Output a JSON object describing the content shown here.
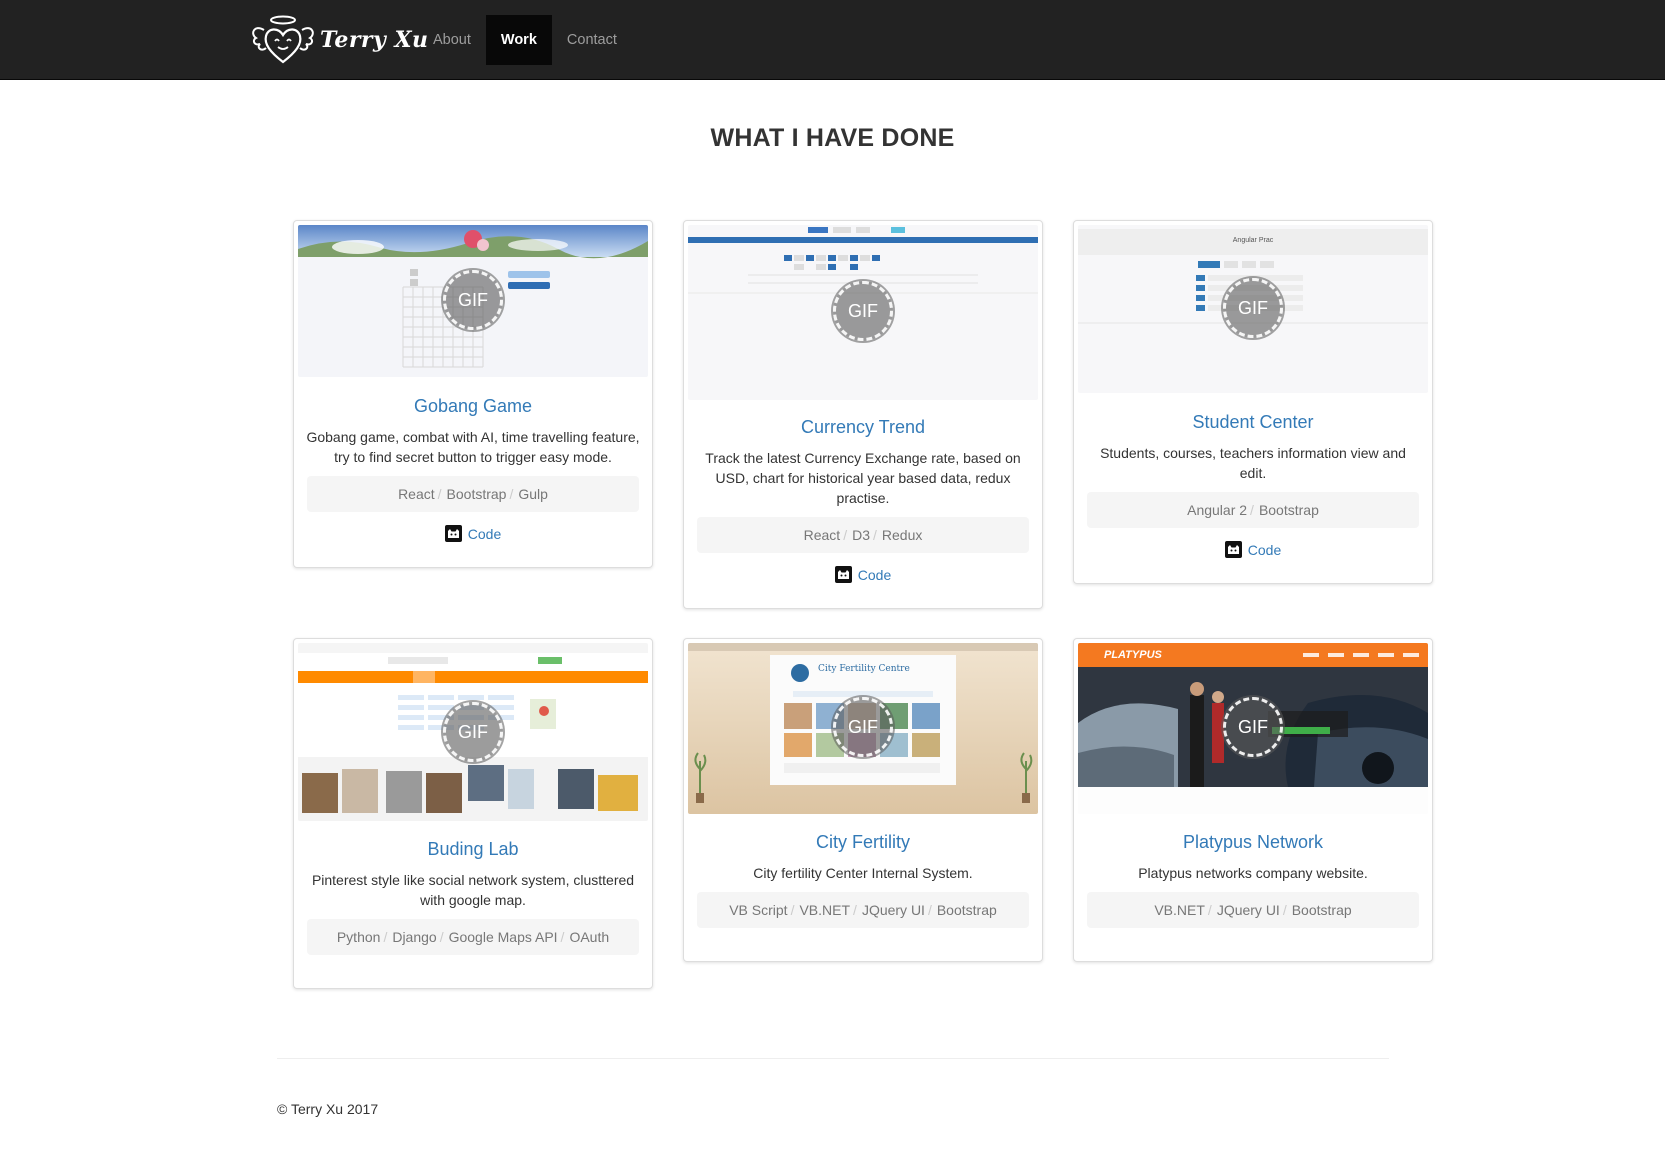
{
  "brand": {
    "name": "Terry Xu",
    "logo_icon": "winged-heart-icon"
  },
  "nav": {
    "items": [
      {
        "label": "About"
      },
      {
        "label": "Work"
      },
      {
        "label": "Contact"
      }
    ],
    "active": "Work"
  },
  "section": {
    "title": "WHAT I HAVE DONE"
  },
  "gif_label": "GIF",
  "projects": [
    {
      "title": "Gobang Game",
      "description": "Gobang game, combat with AI, time travelling feature, try to find secret button to trigger easy mode.",
      "tags": [
        "React",
        "Bootstrap",
        "Gulp"
      ],
      "code_label": "Code"
    },
    {
      "title": "Currency Trend",
      "description": "Track the latest Currency Exchange rate, based on USD, chart for historical year based data, redux practise.",
      "tags": [
        "React",
        "D3",
        "Redux"
      ],
      "code_label": "Code"
    },
    {
      "title": "Student Center",
      "description": "Students, courses, teachers information view and edit.",
      "tags": [
        "Angular 2",
        "Bootstrap"
      ],
      "code_label": "Code",
      "thumb_title": "Angular Prac"
    },
    {
      "title": "Buding Lab",
      "description": "Pinterest style like social network system, clusttered with google map.",
      "tags": [
        "Python",
        "Django",
        "Google Maps API",
        "OAuth"
      ]
    },
    {
      "title": "City Fertility",
      "description": "City fertility Center Internal System.",
      "tags": [
        "VB Script",
        "VB.NET",
        "JQuery UI",
        "Bootstrap"
      ],
      "thumb_title": "City Fertility Centre"
    },
    {
      "title": "Platypus Network",
      "description": "Platypus networks company website.",
      "tags": [
        "VB.NET",
        "JQuery UI",
        "Bootstrap"
      ],
      "thumb_title": "PLATYPUS"
    }
  ],
  "colors": {
    "navbar": "#222222",
    "link": "#337ab7",
    "tag_bg": "#f5f5f5",
    "platypus_orange": "#f47920",
    "buding_orange": "#ff8a00"
  },
  "footer": {
    "text": "© Terry Xu 2017"
  }
}
